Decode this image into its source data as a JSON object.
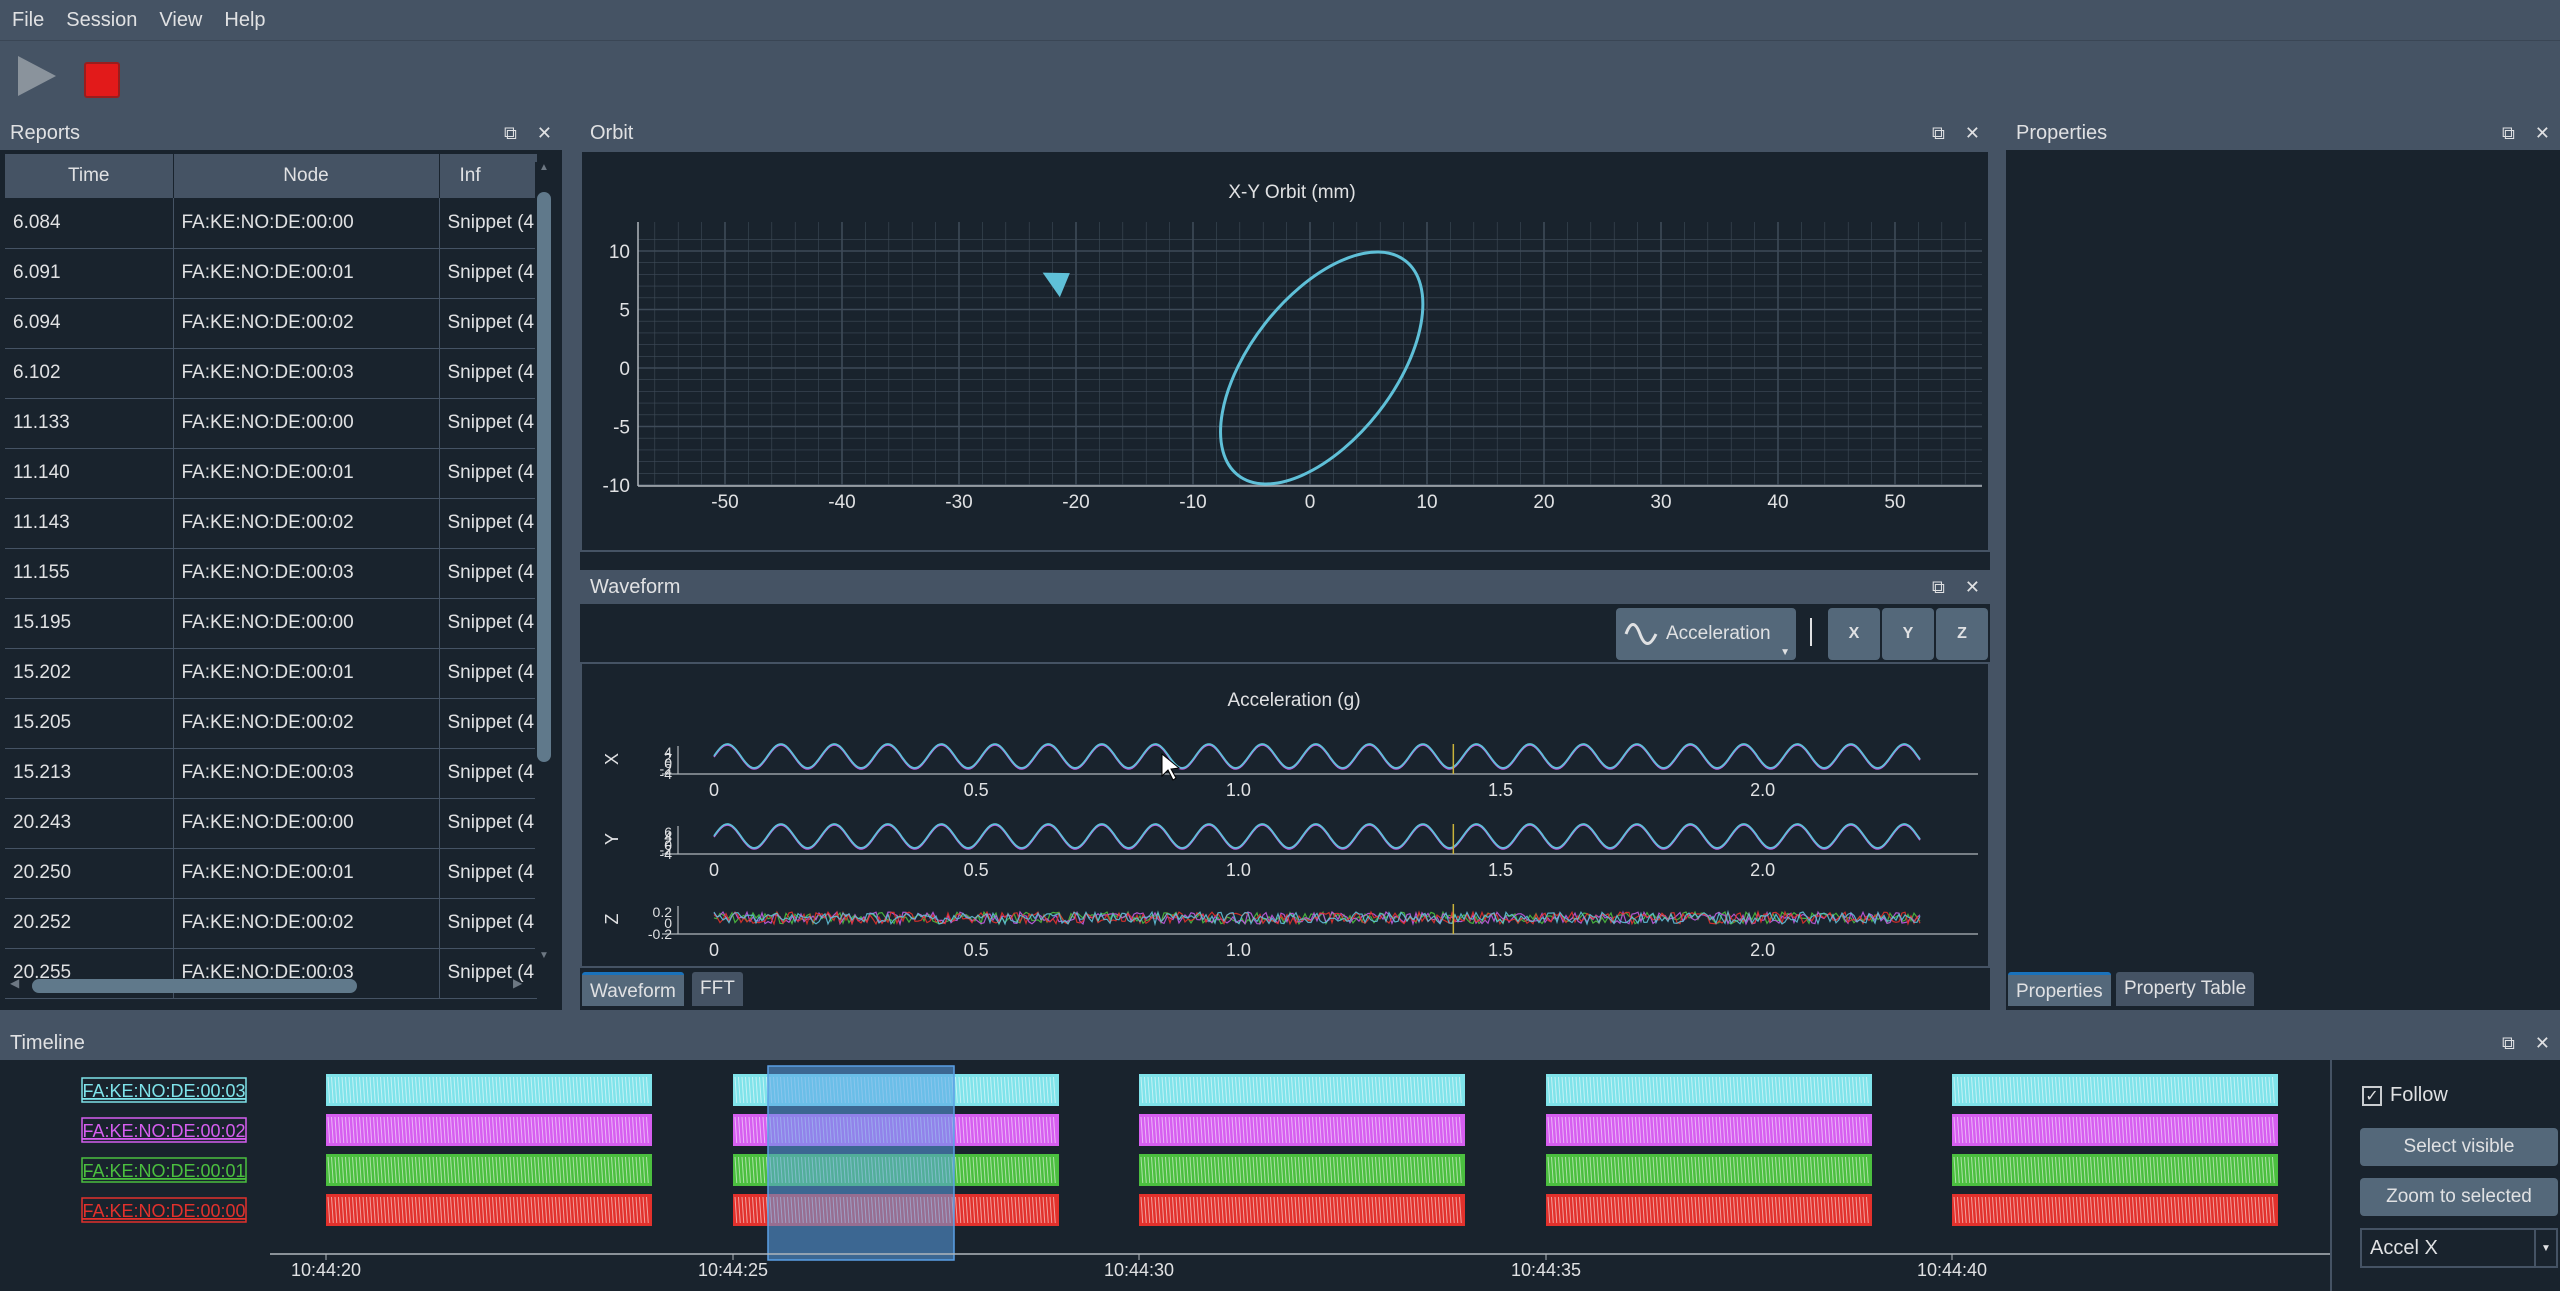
{
  "menu": [
    "File",
    "Session",
    "View",
    "Help"
  ],
  "panels": {
    "reports": "Reports",
    "orbit": "Orbit",
    "waveform": "Waveform",
    "properties": "Properties",
    "timeline": "Timeline"
  },
  "reports": {
    "columns": [
      "Time",
      "Node",
      "Inf"
    ],
    "rows": [
      [
        "6.084",
        "FA:KE:NO:DE:00:00",
        "Snippet (4"
      ],
      [
        "6.091",
        "FA:KE:NO:DE:00:01",
        "Snippet (4"
      ],
      [
        "6.094",
        "FA:KE:NO:DE:00:02",
        "Snippet (4"
      ],
      [
        "6.102",
        "FA:KE:NO:DE:00:03",
        "Snippet (4"
      ],
      [
        "11.133",
        "FA:KE:NO:DE:00:00",
        "Snippet (4"
      ],
      [
        "11.140",
        "FA:KE:NO:DE:00:01",
        "Snippet (4"
      ],
      [
        "11.143",
        "FA:KE:NO:DE:00:02",
        "Snippet (4"
      ],
      [
        "11.155",
        "FA:KE:NO:DE:00:03",
        "Snippet (4"
      ],
      [
        "15.195",
        "FA:KE:NO:DE:00:00",
        "Snippet (4"
      ],
      [
        "15.202",
        "FA:KE:NO:DE:00:01",
        "Snippet (4"
      ],
      [
        "15.205",
        "FA:KE:NO:DE:00:02",
        "Snippet (4"
      ],
      [
        "15.213",
        "FA:KE:NO:DE:00:03",
        "Snippet (4"
      ],
      [
        "20.243",
        "FA:KE:NO:DE:00:00",
        "Snippet (4"
      ],
      [
        "20.250",
        "FA:KE:NO:DE:00:01",
        "Snippet (4"
      ],
      [
        "20.252",
        "FA:KE:NO:DE:00:02",
        "Snippet (4"
      ],
      [
        "20.255",
        "FA:KE:NO:DE:00:03",
        "Snippet (4"
      ]
    ]
  },
  "orbit": {
    "title": "X-Y Orbit (mm)",
    "x_ticks": [
      "-50",
      "-40",
      "-30",
      "-20",
      "-10",
      "0",
      "10",
      "20",
      "30",
      "40",
      "50"
    ],
    "y_ticks": [
      "10",
      "5",
      "0",
      "-5",
      "-10"
    ]
  },
  "waveform_toolbar": {
    "measure_label": "Acceleration",
    "axis_buttons": [
      "X",
      "Y",
      "Z"
    ]
  },
  "acceleration": {
    "title": "Acceleration (g)",
    "x_ticks": [
      "0",
      "0.5",
      "1.0",
      "1.5",
      "2.0"
    ],
    "channels": [
      {
        "label": "X",
        "y_ticks": [
          "4",
          "2",
          "0",
          "-2",
          "-4"
        ]
      },
      {
        "label": "Y",
        "y_ticks": [
          "6",
          "4",
          "2",
          "0",
          "-2",
          "-4"
        ]
      },
      {
        "label": "Z",
        "y_ticks": [
          "0.2",
          "0",
          "-0.2"
        ]
      }
    ]
  },
  "tabs": {
    "waveform": "Waveform",
    "fft": "FFT",
    "properties": "Properties",
    "property_table": "Property Table"
  },
  "timeline": {
    "nodes": [
      {
        "name": "FA:KE:NO:DE:00:03",
        "color": "#7fe3ea"
      },
      {
        "name": "FA:KE:NO:DE:00:02",
        "color": "#d65ef0"
      },
      {
        "name": "FA:KE:NO:DE:00:01",
        "color": "#4bbf3f"
      },
      {
        "name": "FA:KE:NO:DE:00:00",
        "color": "#e2312c"
      }
    ],
    "time_ticks": [
      "10:44:20",
      "10:44:25",
      "10:44:30",
      "10:44:35",
      "10:44:40"
    ],
    "follow_label": "Follow",
    "follow_checked": true,
    "select_visible": "Select visible",
    "zoom_to_selected": "Zoom to selected",
    "channel_select": "Accel X"
  },
  "icons": {
    "play": "play-icon",
    "stop": "stop-icon",
    "float": "float-icon",
    "close": "close-icon",
    "wave": "sine-wave-icon"
  },
  "colors": {
    "accent": "#1a72bb",
    "orbit_line": "#5fc0d8"
  }
}
